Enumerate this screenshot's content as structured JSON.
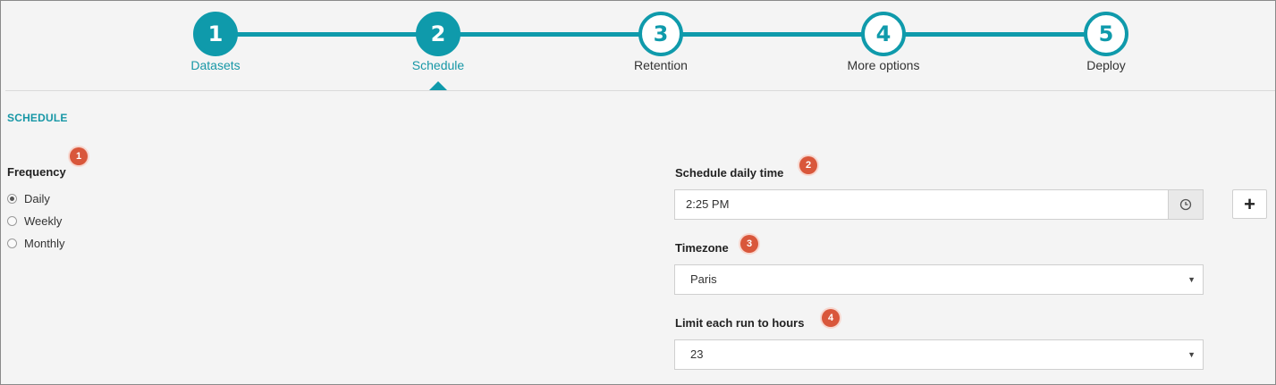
{
  "wizard": {
    "steps": [
      {
        "number": "1",
        "label": "Datasets",
        "state": "done"
      },
      {
        "number": "2",
        "label": "Schedule",
        "state": "active"
      },
      {
        "number": "3",
        "label": "Retention",
        "state": "pending"
      },
      {
        "number": "4",
        "label": "More options",
        "state": "pending"
      },
      {
        "number": "5",
        "label": "Deploy",
        "state": "pending"
      }
    ]
  },
  "section": {
    "title": "SCHEDULE"
  },
  "frequency": {
    "label": "Frequency",
    "badge": "1",
    "options": [
      {
        "label": "Daily",
        "checked": true
      },
      {
        "label": "Weekly",
        "checked": false
      },
      {
        "label": "Monthly",
        "checked": false
      }
    ]
  },
  "schedule_time": {
    "label": "Schedule daily time",
    "badge": "2",
    "value": "2:25 PM",
    "clock_icon": "clock-icon",
    "add_icon": "plus-icon",
    "add_label": "+"
  },
  "timezone": {
    "label": "Timezone",
    "badge": "3",
    "value": "Paris"
  },
  "limit_hours": {
    "label": "Limit each run to hours",
    "badge": "4",
    "value": "23"
  },
  "colors": {
    "accent": "#0f9aab",
    "badge": "#d9573b",
    "background": "#f4f4f4"
  }
}
